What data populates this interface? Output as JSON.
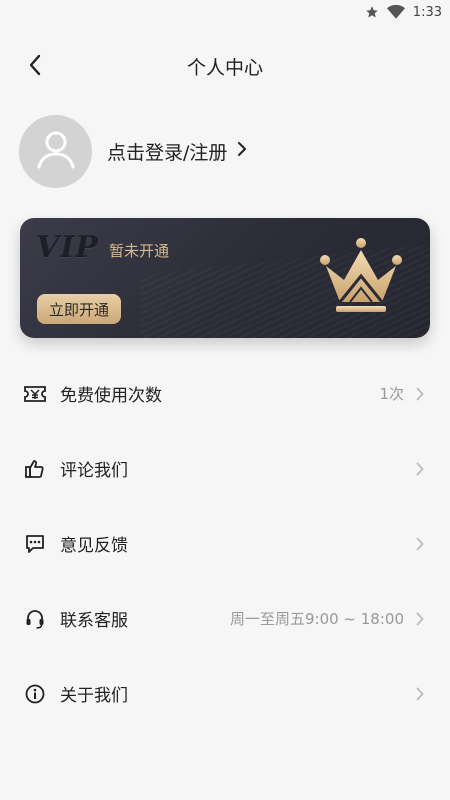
{
  "status_bar": {
    "time": "1:33",
    "icons": [
      "star-icon",
      "wifi-icon"
    ]
  },
  "header": {
    "title": "个人中心",
    "back_icon": "back-arrow-icon"
  },
  "profile": {
    "login_label": "点击登录/注册",
    "avatar_icon": "user-avatar-icon"
  },
  "vip_card": {
    "logo_text": "VIP",
    "status": "暂未开通",
    "open_button": "立即开通",
    "crown_icon": "crown-icon",
    "colors": {
      "gold": "#d8b88c",
      "card": "#2b2c36"
    }
  },
  "menu": [
    {
      "icon": "ticket-icon",
      "label": "免费使用次数",
      "value": "1次"
    },
    {
      "icon": "thumbs-up-icon",
      "label": "评论我们",
      "value": ""
    },
    {
      "icon": "feedback-chat-icon",
      "label": "意见反馈",
      "value": ""
    },
    {
      "icon": "headset-icon",
      "label": "联系客服",
      "value": "周一至周五9:00 ~ 18:00"
    },
    {
      "icon": "info-icon",
      "label": "关于我们",
      "value": ""
    }
  ]
}
